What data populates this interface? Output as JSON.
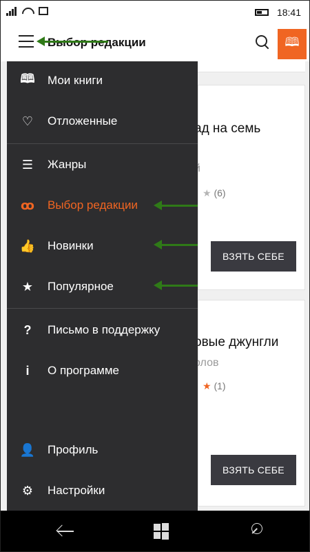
{
  "status_bar": {
    "time": "18:41",
    "icons": [
      "signal-icon",
      "wifi-calling-icon",
      "message-icon",
      "battery-icon"
    ]
  },
  "header": {
    "title": "Выбор редакции",
    "menu_icon": "hamburger-icon",
    "search_icon": "search-icon",
    "library_icon": "book-icon",
    "library_glyph": "🕮",
    "accent_color": "#f06522"
  },
  "drawer": {
    "items": [
      {
        "label": "Мои книги",
        "icon": "open-book-icon",
        "glyph": "🕮"
      },
      {
        "label": "Отложенные",
        "icon": "heart-icon",
        "glyph": "♡"
      },
      {
        "label": "Жанры",
        "icon": "stack-icon",
        "glyph": "☰"
      },
      {
        "label": "Выбор редакции",
        "icon": "glasses-icon",
        "glyph": "ꝏ",
        "active": true
      },
      {
        "label": "Новинки",
        "icon": "thumbs-up-icon",
        "glyph": "👍"
      },
      {
        "label": "Популярное",
        "icon": "star-icon",
        "glyph": "★"
      },
      {
        "label": "Письмо в поддержку",
        "icon": "question-icon",
        "glyph": "?"
      },
      {
        "label": "О программе",
        "icon": "info-icon",
        "glyph": "i"
      },
      {
        "label": "Профиль",
        "icon": "person-icon",
        "glyph": "👤"
      },
      {
        "label": "Настройки",
        "icon": "gear-icon",
        "glyph": "⚙"
      }
    ],
    "background": "#2d2d2f",
    "active_color": "#f06522"
  },
  "cards": [
    {
      "title": "ад на семь",
      "author": "й",
      "rating_count": "(6)",
      "button": "ВЗЯТЬ СЕБЕ"
    },
    {
      "title": "овые джунгли",
      "author": "олов",
      "rating_count": "(1)",
      "button": "ВЗЯТЬ СЕБЕ"
    }
  ],
  "bottom_nav": {
    "icons": [
      "back-arrow-icon",
      "windows-logo-icon",
      "search-icon"
    ]
  },
  "annotation_color": "#2f7a17"
}
